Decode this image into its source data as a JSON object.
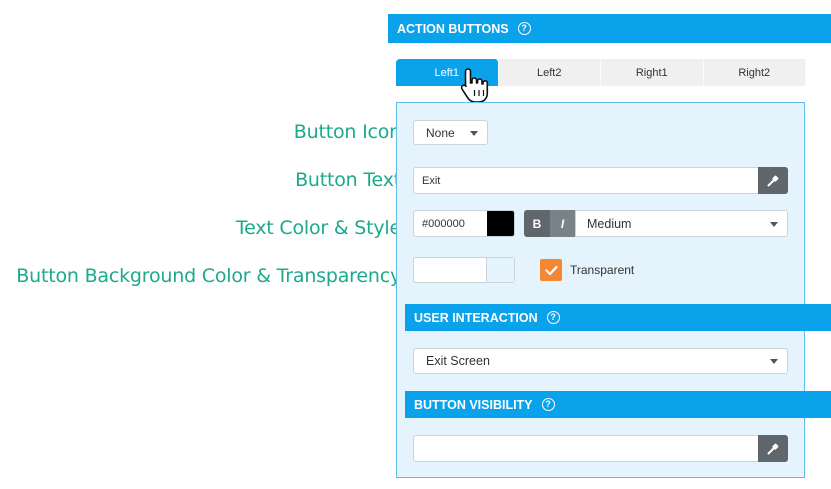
{
  "annotations": {
    "button_icon": "Button Icon",
    "button_text": "Button Text",
    "text_color_style": "Text Color & Style",
    "bg_color_transparency": "Button Background Color & Transparency"
  },
  "header": {
    "title": "ACTION BUTTONS",
    "help": "?"
  },
  "tabs": [
    {
      "label": "Left1",
      "active": true
    },
    {
      "label": "Left2",
      "active": false
    },
    {
      "label": "Right1",
      "active": false
    },
    {
      "label": "Right2",
      "active": false
    }
  ],
  "icon_select": {
    "value": "None"
  },
  "text_input": {
    "value": "Exit"
  },
  "text_color": {
    "hex": "#000000",
    "swatch": "#000000"
  },
  "style_buttons": {
    "bold": "B",
    "italic": "I"
  },
  "weight_select": {
    "value": "Medium"
  },
  "transparent": {
    "label": "Transparent",
    "checked": true
  },
  "user_interaction": {
    "title": "USER INTERACTION",
    "help": "?",
    "value": "Exit Screen"
  },
  "button_visibility": {
    "title": "BUTTON VISIBILITY",
    "help": "?",
    "value": ""
  },
  "colors": {
    "accent": "#0ba2ec",
    "annotation": "#1ca98c",
    "checkbox": "#f58634"
  }
}
